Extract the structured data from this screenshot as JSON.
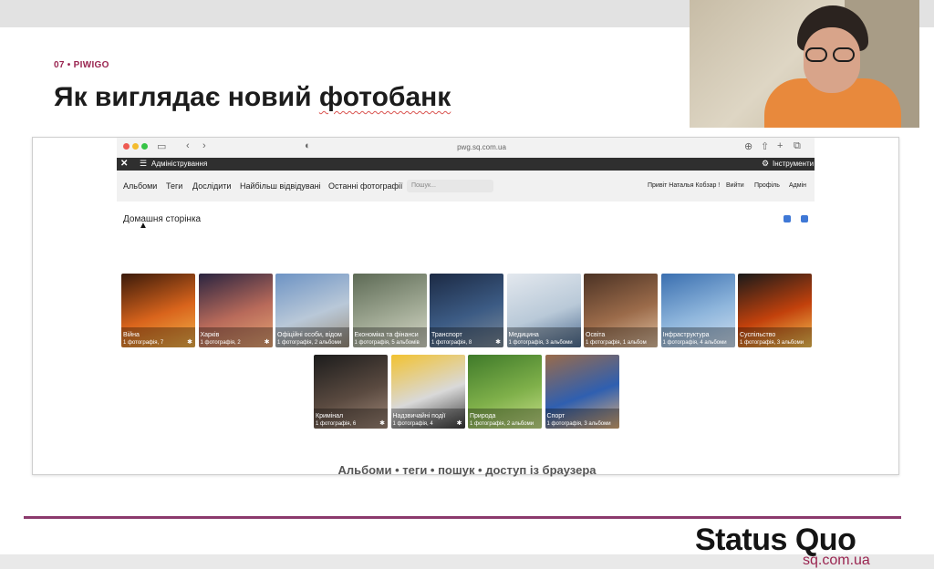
{
  "slide": {
    "section_label": "07 • PIWIGO",
    "title_start": "Як виглядає новий ",
    "title_underlined": "фотобанк",
    "caption": "Альбоми  •  теги  •  пошук  •  доступ із браузера"
  },
  "browser": {
    "url": "pwg.sq.com.ua",
    "admin_bar": {
      "label": "Адміністрування",
      "tools": "Інструменти"
    },
    "nav": [
      "Альбоми",
      "Теги",
      "Дослідити",
      "Найбільш відвідувані",
      "Останні фотографії"
    ],
    "search_placeholder": "Пошук...",
    "user_links": [
      "Привіт Наталья Кобзар !",
      "Вийти",
      "Профіль",
      "Адмін"
    ],
    "breadcrumb": "Домашня сторінка"
  },
  "albums": [
    {
      "name": "Війна",
      "count": "1 фотографія, 7",
      "colors": [
        "#3a1a0a",
        "#d9641c",
        "#f3b34a"
      ]
    },
    {
      "name": "Харків",
      "count": "1 фотографія, 2",
      "colors": [
        "#2a2440",
        "#b86a5a",
        "#e6a574"
      ]
    },
    {
      "name": "Офіційні особи, відом",
      "count": "1 фотографія, 2 альбоми",
      "colors": [
        "#6d93c4",
        "#b9c8d8",
        "#9a8e7c"
      ]
    },
    {
      "name": "Економіка та фінанси",
      "count": "1 фотографія, 5 альбомів",
      "colors": [
        "#5d6a55",
        "#9fa893",
        "#d6d8c8"
      ]
    },
    {
      "name": "Транспорт",
      "count": "1 фотографія, 8",
      "colors": [
        "#1c2a44",
        "#3c5b84",
        "#7e8c9a"
      ]
    },
    {
      "name": "Медицина",
      "count": "1 фотографія, 3 альбоми",
      "colors": [
        "#e3e8ee",
        "#b9c9d8",
        "#4d6b8f"
      ]
    },
    {
      "name": "Освіта",
      "count": "1 фотографія, 1 альбом",
      "colors": [
        "#4b3224",
        "#9b6b4a",
        "#e0c0a0"
      ]
    },
    {
      "name": "Інфраструктура",
      "count": "1 фотографія, 4 альбоми",
      "colors": [
        "#3a6fb0",
        "#8fb6dc",
        "#cfdff0"
      ]
    },
    {
      "name": "Суспільство",
      "count": "1 фотографія, 3 альбоми",
      "colors": [
        "#1a1a1a",
        "#c2410c",
        "#f6c453"
      ]
    },
    {
      "name": "Кримінал",
      "count": "1 фотографія, 6",
      "colors": [
        "#1c1c1c",
        "#5a4a40",
        "#a08878"
      ]
    },
    {
      "name": "Надзвичайні події",
      "count": "1 фотографія, 4",
      "colors": [
        "#f2c230",
        "#d9d9d9",
        "#3a3a3a"
      ]
    },
    {
      "name": "Природа",
      "count": "1 фотографія, 2 альбоми",
      "colors": [
        "#3f7a2a",
        "#7fb04a",
        "#c8e08a"
      ]
    },
    {
      "name": "Спорт",
      "count": "1 фотографія, 3 альбоми",
      "colors": [
        "#9a6b4a",
        "#2f5fb0",
        "#e0b07a"
      ]
    }
  ],
  "footer": {
    "logo": "Status Quo",
    "site": "sq.com.ua"
  }
}
